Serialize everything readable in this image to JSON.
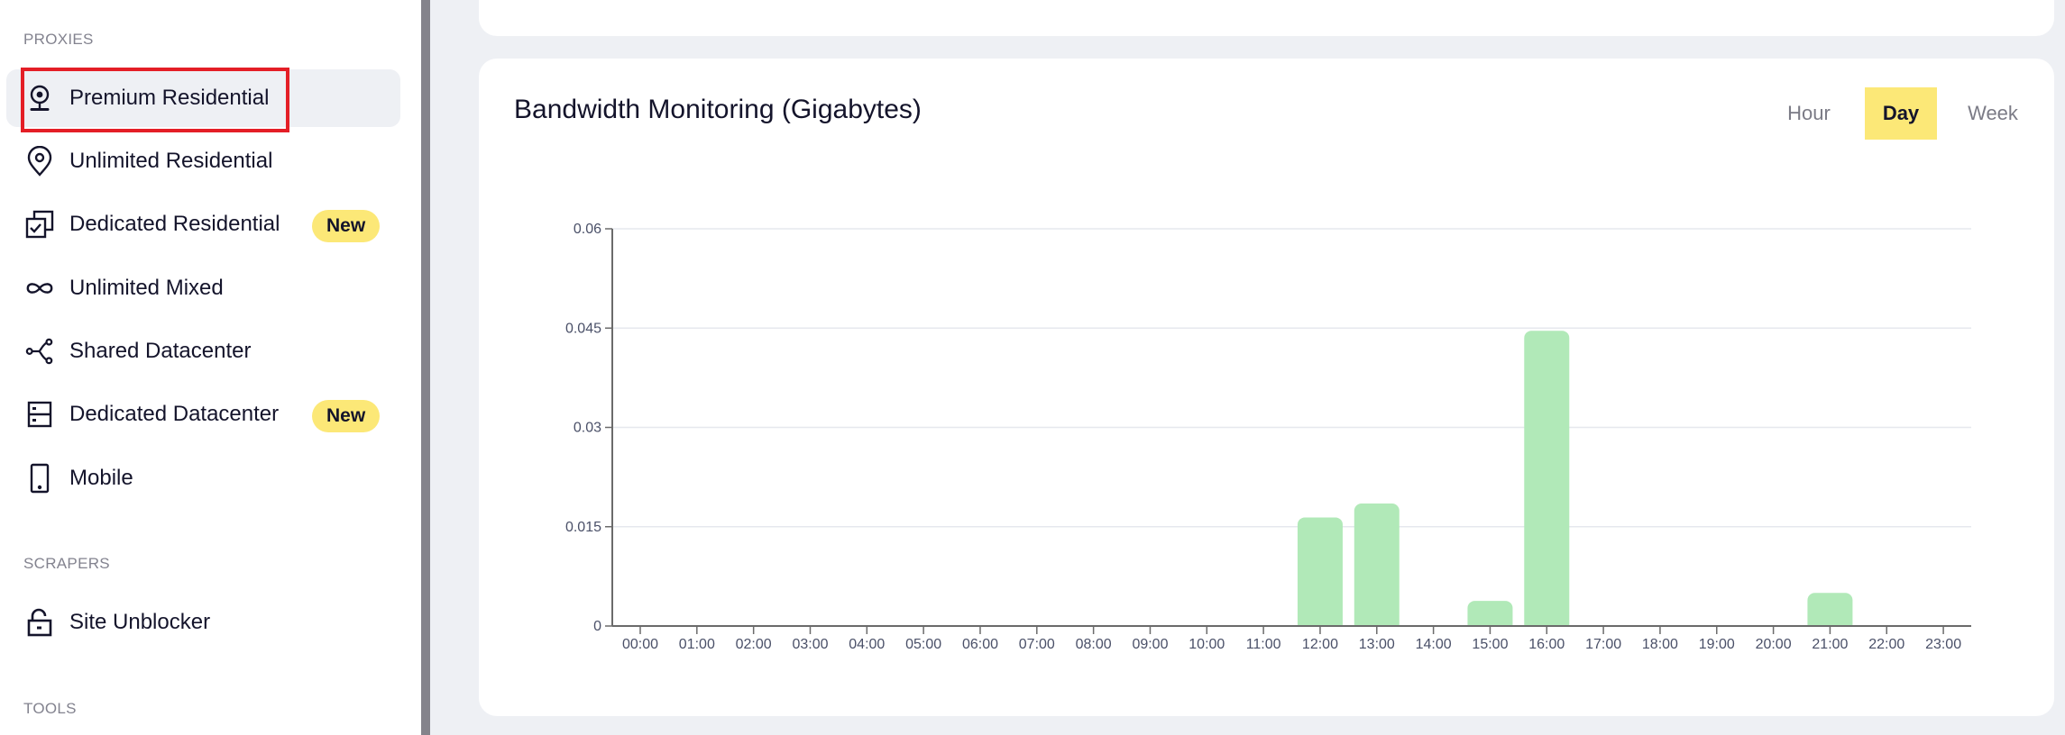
{
  "sidebar": {
    "sections": [
      {
        "label": "PROXIES"
      },
      {
        "label": "SCRAPERS"
      },
      {
        "label": "TOOLS"
      }
    ],
    "items": [
      {
        "label": "Premium Residential",
        "icon": "webcam-pin-icon",
        "active": true
      },
      {
        "label": "Unlimited Residential",
        "icon": "location-pin-icon"
      },
      {
        "label": "Dedicated Residential",
        "icon": "stacked-check-icon",
        "badge": "New"
      },
      {
        "label": "Unlimited Mixed",
        "icon": "infinity-icon"
      },
      {
        "label": "Shared Datacenter",
        "icon": "share-nodes-icon"
      },
      {
        "label": "Dedicated Datacenter",
        "icon": "server-icon",
        "badge": "New"
      },
      {
        "label": "Mobile",
        "icon": "mobile-phone-icon"
      },
      {
        "label": "Site Unblocker",
        "icon": "unlock-icon"
      }
    ]
  },
  "card": {
    "title": "Bandwidth Monitoring (Gigabytes)",
    "range_tabs": [
      {
        "label": "Hour"
      },
      {
        "label": "Day",
        "active": true
      },
      {
        "label": "Week"
      }
    ]
  },
  "colors": {
    "accent_yellow": "#fce877",
    "bar_green": "#b1e9b8",
    "highlight_red": "#e41e26"
  },
  "chart_data": {
    "type": "bar",
    "title": "Bandwidth Monitoring (Gigabytes)",
    "xlabel": "",
    "ylabel": "",
    "ylim": [
      0,
      0.06
    ],
    "yticks": [
      "0",
      "0.015",
      "0.03",
      "0.045",
      "0.06"
    ],
    "ytick_values": [
      0,
      0.015,
      0.03,
      0.045,
      0.06
    ],
    "grid": true,
    "categories": [
      "00:00",
      "01:00",
      "02:00",
      "03:00",
      "04:00",
      "05:00",
      "06:00",
      "07:00",
      "08:00",
      "09:00",
      "10:00",
      "11:00",
      "12:00",
      "13:00",
      "14:00",
      "15:00",
      "16:00",
      "17:00",
      "18:00",
      "19:00",
      "20:00",
      "21:00",
      "22:00",
      "23:00"
    ],
    "values": [
      0,
      0,
      0,
      0,
      0,
      0,
      0,
      0,
      0,
      0,
      0,
      0,
      0.0164,
      0.0185,
      0,
      0.0038,
      0.0446,
      0,
      0,
      0,
      0.0001,
      0.005,
      0,
      0
    ]
  }
}
